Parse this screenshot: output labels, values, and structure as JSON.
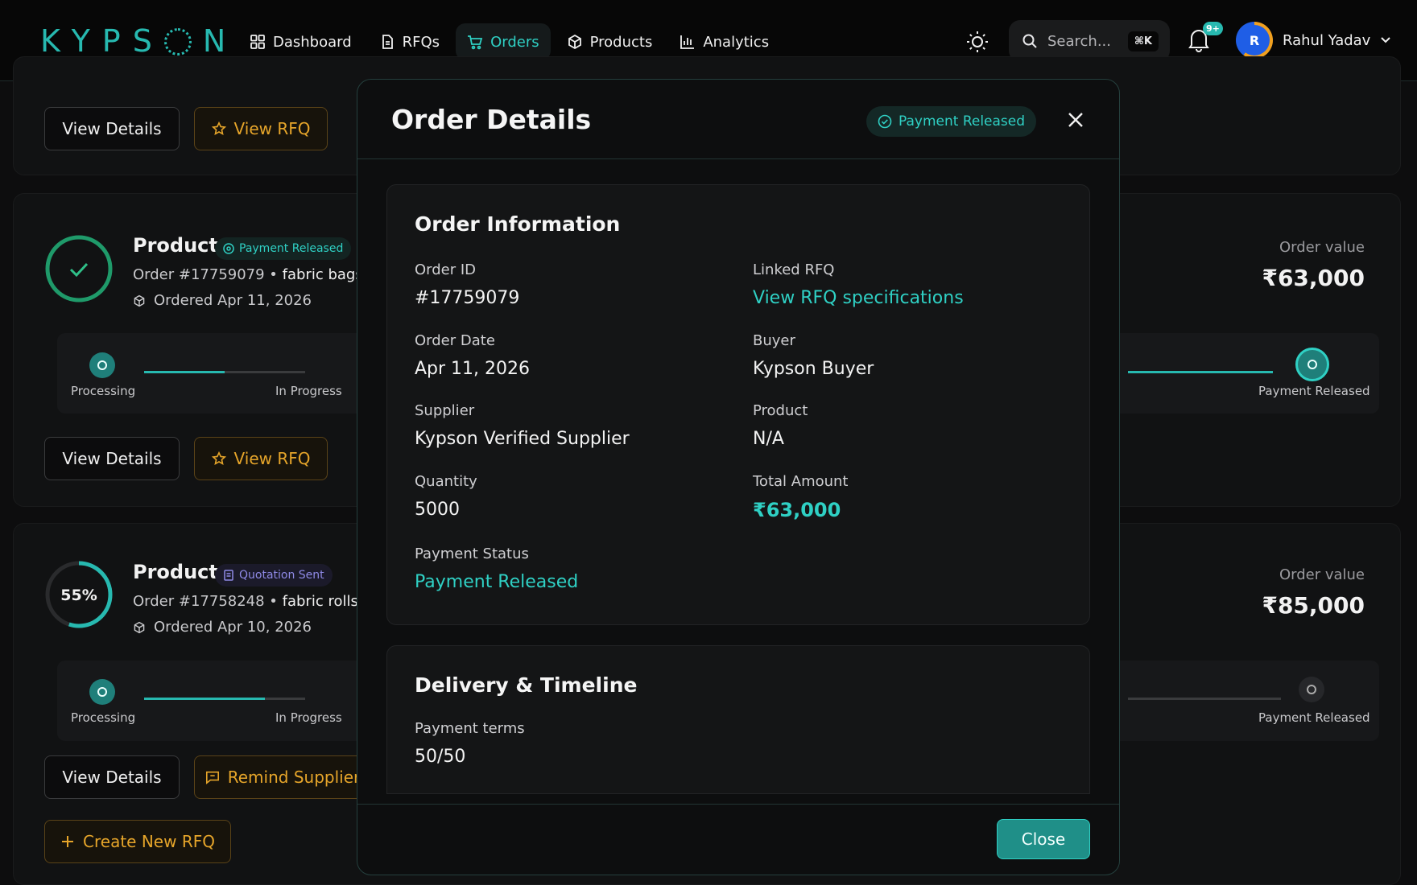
{
  "brand": {
    "logo_text": "KYPSON",
    "accent": "#27b9b0"
  },
  "nav": {
    "items": [
      {
        "label": "Dashboard",
        "icon": "grid-icon",
        "active": false
      },
      {
        "label": "RFQs",
        "icon": "document-icon",
        "active": false
      },
      {
        "label": "Orders",
        "icon": "cart-icon",
        "active": true
      },
      {
        "label": "Products",
        "icon": "box-icon",
        "active": false
      },
      {
        "label": "Analytics",
        "icon": "bar-chart-icon",
        "active": false
      }
    ]
  },
  "header": {
    "search_placeholder": "Search...",
    "search_shortcut": "⌘K",
    "notification_count": "9+",
    "user_initial": "R",
    "user_name": "Rahul Yadav"
  },
  "cards": [
    {
      "buttons": {
        "details": "View Details",
        "rfq": "View RFQ"
      }
    },
    {
      "title": "Product",
      "status": "Payment Released",
      "order_no": "Order #17759079",
      "item": "fabric bags",
      "ordered": "Ordered Apr 11, 2026",
      "order_value_label": "Order value",
      "order_value": "₹63,000",
      "steps": [
        "Processing",
        "In Progress",
        "Payment Released"
      ],
      "progress_fraction": 0.5,
      "buttons": {
        "details": "View Details",
        "rfq": "View RFQ"
      }
    },
    {
      "title": "Product",
      "status": "Quotation Sent",
      "progress_label": "55%",
      "progress": 0.55,
      "order_no": "Order #17758248",
      "item": "fabric rolls",
      "ordered": "Ordered Apr 10, 2026",
      "order_value_label": "Order value",
      "order_value": "₹85,000",
      "steps": [
        "Processing",
        "In Progress",
        "Payment Released"
      ],
      "progress_fraction": 0.75,
      "buttons": {
        "details": "View Details",
        "remind": "Remind Supplier"
      }
    }
  ],
  "create_rfq_label": "Create New RFQ",
  "modal": {
    "title": "Order Details",
    "status_badge": "Payment Released",
    "order_info": {
      "title": "Order Information",
      "order_id_label": "Order ID",
      "order_id": "#17759079",
      "linked_rfq_label": "Linked RFQ",
      "linked_rfq": "View RFQ specifications",
      "order_date_label": "Order Date",
      "order_date": "Apr 11, 2026",
      "buyer_label": "Buyer",
      "buyer": "Kypson Buyer",
      "supplier_label": "Supplier",
      "supplier": "Kypson Verified Supplier",
      "product_label": "Product",
      "product": "N/A",
      "quantity_label": "Quantity",
      "quantity": "5000",
      "total_label": "Total Amount",
      "total": "₹63,000",
      "payment_status_label": "Payment Status",
      "payment_status": "Payment Released"
    },
    "delivery": {
      "title": "Delivery & Timeline",
      "payment_terms_label": "Payment terms",
      "payment_terms": "50/50"
    },
    "close_label": "Close"
  }
}
